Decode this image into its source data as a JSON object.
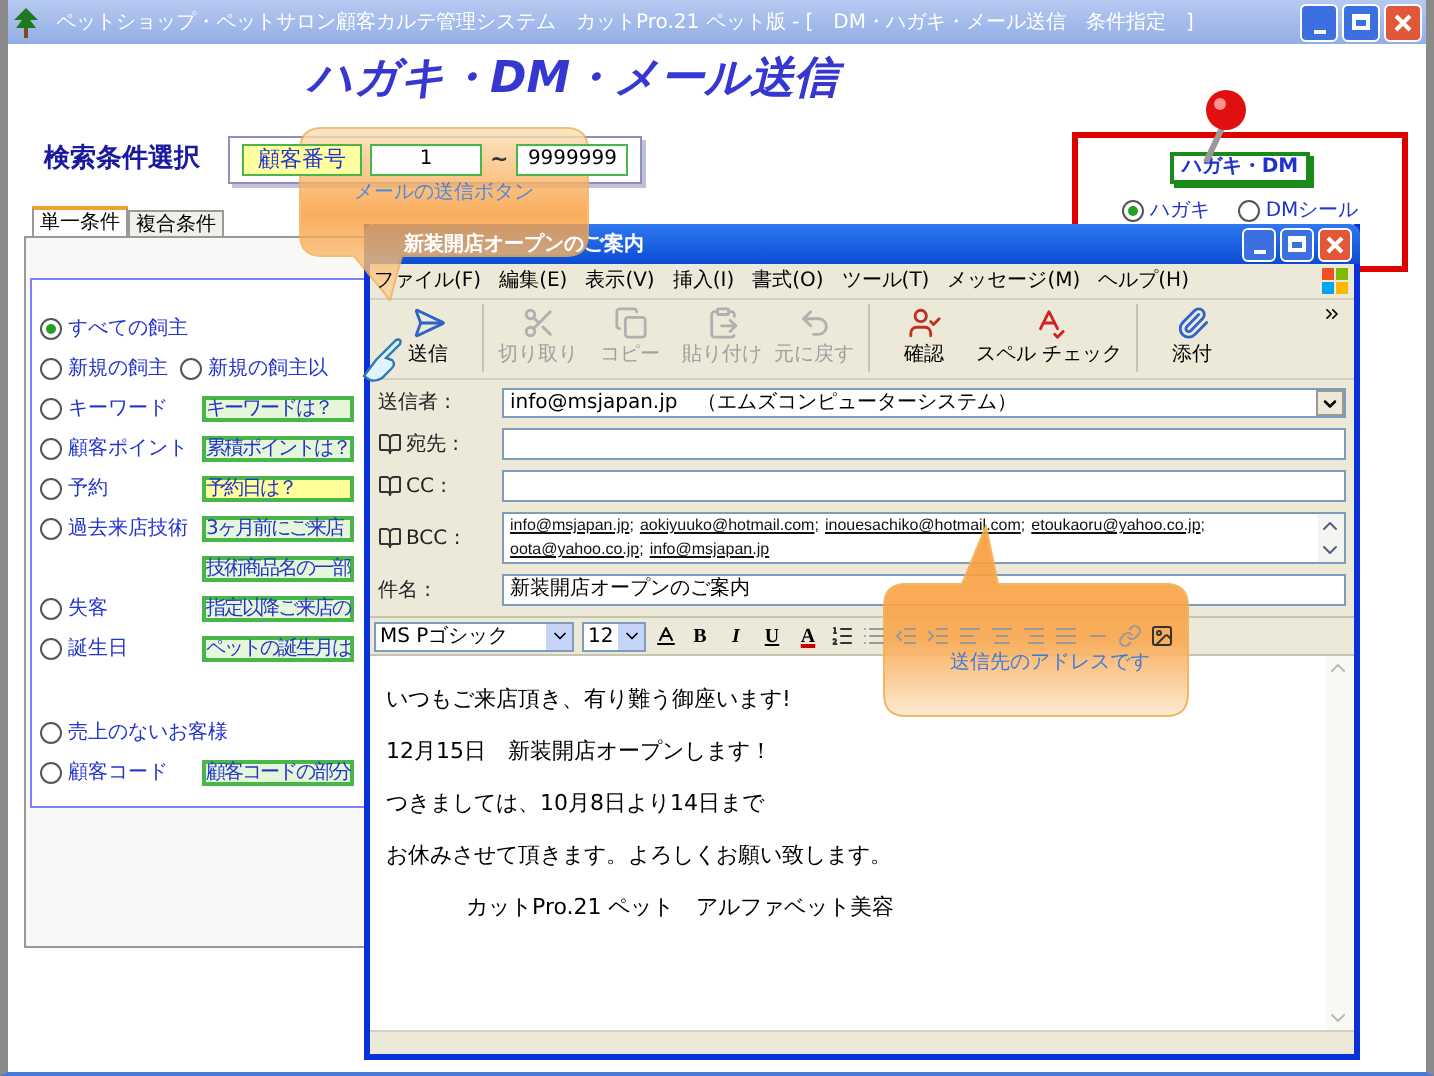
{
  "main_window": {
    "title": "ペットショップ・ペットサロン顧客カルテ管理システム　カットPro.21 ペット版 - [　DM・ハガキ・メール送信　条件指定　]"
  },
  "heading": "ハガキ・DM・メール送信",
  "search": {
    "label": "検索条件選択",
    "field_label": "顧客番号",
    "from": "1",
    "separator": "~",
    "to": "9999999"
  },
  "tabs": [
    {
      "label": "単一条件",
      "selected": true
    },
    {
      "label": "複合条件",
      "selected": false
    }
  ],
  "conditions": [
    {
      "options": [
        {
          "label": "すべての飼主",
          "selected": true
        }
      ]
    },
    {
      "options": [
        {
          "label": "新規の飼主",
          "selected": false
        },
        {
          "label": "新規の飼主以",
          "selected": false
        }
      ]
    },
    {
      "options": [
        {
          "label": "キーワード",
          "selected": false
        }
      ],
      "field": {
        "value": "キーワードは？",
        "color": "#e6f7d9"
      }
    },
    {
      "options": [
        {
          "label": "顧客ポイント",
          "selected": false
        }
      ],
      "field": {
        "value": "累積ポイントは？",
        "color": "#e6f7d9"
      }
    },
    {
      "options": [
        {
          "label": "予約",
          "selected": false
        }
      ],
      "field": {
        "value": "予約日は？",
        "color": "#ffff99"
      }
    },
    {
      "options": [
        {
          "label": "過去来店技術",
          "selected": false
        }
      ],
      "field": {
        "value": "3ヶ月前にご来店",
        "color": "#e6f7d9"
      }
    },
    {
      "field": {
        "value": "技術商品名の一部",
        "color": "#e6f7d9"
      }
    },
    {
      "options": [
        {
          "label": "失客",
          "selected": false
        }
      ],
      "field": {
        "value": "指定以降ご来店の",
        "color": "#e6f7d9"
      }
    },
    {
      "options": [
        {
          "label": "誕生日",
          "selected": false
        }
      ],
      "field": {
        "value": "ペットの誕生月は",
        "color": "#e6f7d9"
      }
    }
  ],
  "other_conditions": [
    {
      "options": [
        {
          "label": "売上のないお客様",
          "selected": false
        }
      ]
    },
    {
      "options": [
        {
          "label": "顧客コード",
          "selected": false
        }
      ],
      "field": {
        "value": "顧客コードの部分",
        "color": "#e6f7d9"
      }
    }
  ],
  "postcard": {
    "label": "ハガキ・DM",
    "options": [
      {
        "label": "ハガキ",
        "selected": true
      },
      {
        "label": "DMシール",
        "selected": false
      }
    ]
  },
  "mail_window": {
    "title": "新装開店オープンのご案内",
    "menu": [
      "ファイル(F)",
      "編集(E)",
      "表示(V)",
      "挿入(I)",
      "書式(O)",
      "ツール(T)",
      "メッセージ(M)",
      "ヘルプ(H)"
    ],
    "toolbar": [
      {
        "kind": "send",
        "label": "送信",
        "disabled": false
      },
      {
        "kind": "cut",
        "label": "切り取り",
        "disabled": true
      },
      {
        "kind": "copy",
        "label": "コピー",
        "disabled": true
      },
      {
        "kind": "paste",
        "label": "貼り付け",
        "disabled": true
      },
      {
        "kind": "undo",
        "label": "元に戻す",
        "disabled": true
      },
      {
        "kind": "check",
        "label": "確認",
        "disabled": false
      },
      {
        "kind": "spell",
        "label": "スペル チェック",
        "disabled": false
      },
      {
        "kind": "attach",
        "label": "添付",
        "disabled": false
      }
    ],
    "header_fields": [
      {
        "kind": "select",
        "label": "送信者 :",
        "value": "info@msjapan.jp　（エムズコンピューターシステム）"
      },
      {
        "kind": "address",
        "label": "宛先 :"
      },
      {
        "kind": "address",
        "label": "CC :"
      },
      {
        "kind": "address_list",
        "label": "BCC :",
        "addresses": [
          {
            "address": "info@msjapan.jp",
            "separator": ";"
          },
          {
            "address": "aokiyuuko@hotmail.com",
            "separator": ";"
          },
          {
            "address": "inouesachiko@hotmail.com",
            "separator": ";"
          },
          {
            "address": "etoukaoru@yahoo.co.jp",
            "separator": ";"
          },
          {
            "address": "oota@yahoo.co.jp",
            "separator": ";"
          },
          {
            "address": "info@msjapan.jp"
          }
        ]
      },
      {
        "kind": "text",
        "label": "件名 :",
        "value": "新装開店オープンのご案内"
      }
    ],
    "format": {
      "font": "MS Pゴシック",
      "size": "12",
      "buttons": [
        "B",
        "I",
        "U",
        "A"
      ]
    },
    "body": [
      {
        "text": "いつもご来店頂き、有り難う御座います!",
        "indented": false
      },
      {
        "text": "12月15日　新装開店オープンします！",
        "indented": false
      },
      {
        "text": "つきましては、10月8日より14日まで",
        "indented": false
      },
      {
        "text": "お休みさせて頂きます。よろしくお願い致します。",
        "indented": false
      },
      {
        "text": "カットPro.21 ペット　アルファベット美容",
        "indented": true
      }
    ]
  },
  "callouts": [
    {
      "text": "メールの送信ボタン"
    },
    {
      "text": "送信先のアドレスです"
    }
  ]
}
